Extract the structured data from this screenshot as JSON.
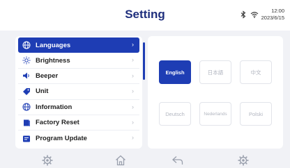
{
  "header": {
    "title": "Setting",
    "time": "12:00",
    "date": "2023/6/15",
    "icons": [
      "bluetooth-icon",
      "wifi-icon"
    ]
  },
  "sidebar": {
    "items": [
      {
        "label": "Languages",
        "icon": "globe-icon",
        "active": true
      },
      {
        "label": "Brightness",
        "icon": "sun-icon",
        "active": false
      },
      {
        "label": "Beeper",
        "icon": "speaker-icon",
        "active": false
      },
      {
        "label": "Unit",
        "icon": "tag-icon",
        "active": false
      },
      {
        "label": "Information",
        "icon": "globe-icon",
        "active": false
      },
      {
        "label": "Factory Reset",
        "icon": "book-icon",
        "active": false
      },
      {
        "label": "Program Update",
        "icon": "update-icon",
        "active": false
      }
    ],
    "chevron": "›"
  },
  "languages": {
    "selected": "English",
    "options": [
      "English",
      "日本語",
      "中文",
      "Deutsch",
      "Nederlands",
      "Polski"
    ]
  },
  "bottom_nav": [
    "settings-icon",
    "home-icon",
    "back-icon",
    "settings-icon"
  ],
  "colors": {
    "accent": "#1e3db4",
    "title": "#1f2f7d",
    "background": "#f1f2f6"
  }
}
